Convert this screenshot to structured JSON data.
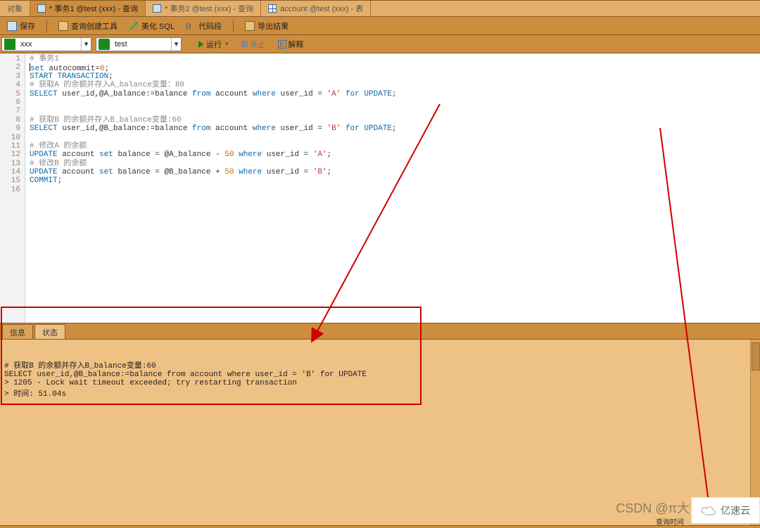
{
  "tabs": [
    {
      "label": "对象",
      "marker": "",
      "icon": ""
    },
    {
      "label": "* 事务1 @test (xxx) - 查询",
      "marker": "",
      "icon": "table"
    },
    {
      "label": "* 事务2 @test (xxx) - 查询",
      "marker": "",
      "icon": "table"
    },
    {
      "label": "account @test (xxx) - 表",
      "marker": "",
      "icon": "grid"
    }
  ],
  "active_tab_index": 1,
  "toolbar": {
    "save": "保存",
    "qbuilder": "查询创建工具",
    "beautify": "美化 SQL",
    "codeseg": "代码段",
    "export": "导出结果"
  },
  "conn": {
    "connection": "xxx",
    "database": "test",
    "run": "运行",
    "stop": "停止",
    "explain": "解释"
  },
  "editor": {
    "lines": [
      {
        "n": 1,
        "type": "cmt",
        "text": "# 事务1"
      },
      {
        "n": 2,
        "type": "code",
        "text_html": "<span class='caret'></span><span class='tk-kw'>set</span> autocommit=<span class='tk-num'>0</span>;"
      },
      {
        "n": 3,
        "type": "code",
        "text_html": "<span class='tk-kw'>START</span> <span class='tk-kw'>TRANSACTION</span>;"
      },
      {
        "n": 4,
        "type": "cmt",
        "text": "# 获取A 的余额并存入A_balance变量：80"
      },
      {
        "n": 5,
        "type": "code",
        "text_html": "<span class='tk-kw'>SELECT</span> user_id,@A_balance:=balance <span class='tk-kw'>from</span> account <span class='tk-kw'>where</span> user_id = <span class='tk-str'>'A'</span> <span class='tk-kw'>for</span> <span class='tk-kw'>UPDATE</span>;"
      },
      {
        "n": 6,
        "type": "blank",
        "text": ""
      },
      {
        "n": 7,
        "type": "blank",
        "text": ""
      },
      {
        "n": 8,
        "type": "cmt",
        "text": "# 获取B 的余额并存入B_balance变量:60"
      },
      {
        "n": 9,
        "type": "code",
        "text_html": "<span class='tk-kw'>SELECT</span> user_id,@B_balance:=balance <span class='tk-kw'>from</span> account <span class='tk-kw'>where</span> user_id = <span class='tk-str'>'B'</span> <span class='tk-kw'>for</span> <span class='tk-kw'>UPDATE</span>;"
      },
      {
        "n": 10,
        "type": "blank",
        "text": ""
      },
      {
        "n": 11,
        "type": "cmt",
        "text": "# 修改A 的余额"
      },
      {
        "n": 12,
        "type": "code",
        "text_html": "<span class='tk-kw'>UPDATE</span> account <span class='tk-kw'>set</span> balance = @A_balance - <span class='tk-num'>50</span> <span class='tk-kw'>where</span> user_id = <span class='tk-str'>'A'</span>;"
      },
      {
        "n": 13,
        "type": "cmt",
        "text": "# 修改B 的余额"
      },
      {
        "n": 14,
        "type": "code",
        "text_html": "<span class='tk-kw'>UPDATE</span> account <span class='tk-kw'>set</span> balance = @B_balance + <span class='tk-num'>50</span> <span class='tk-kw'>where</span> user_id = <span class='tk-str'>'B'</span>;"
      },
      {
        "n": 15,
        "type": "code",
        "text_html": "<span class='tk-kw'>COMMIT</span>;"
      },
      {
        "n": 16,
        "type": "blank",
        "text": ""
      }
    ]
  },
  "output": {
    "tabs": {
      "info": "信息",
      "status": "状态"
    },
    "active": "status",
    "lines": [
      "# 获取B 的余额并存入B_balance变量:60",
      "SELECT user_id,@B_balance:=balance from account where user_id = 'B' for UPDATE",
      "> 1205 - Lock wait timeout exceeded; try restarting transaction",
      "> 时间: 51.04s"
    ]
  },
  "watermark": {
    "csdn": "CSDN @π大",
    "cloud": "亿速云"
  },
  "footer_label": "查询时间"
}
